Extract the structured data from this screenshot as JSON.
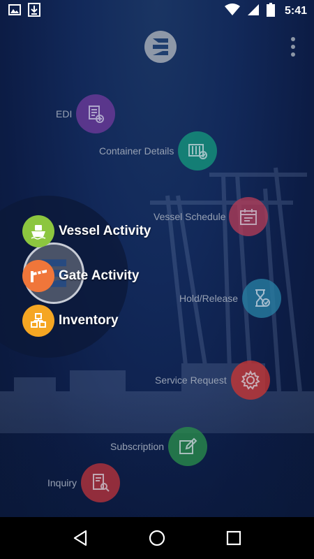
{
  "status_bar": {
    "time": "5:41",
    "icons": [
      "image-icon",
      "download-icon",
      "wifi-icon",
      "signal-icon",
      "battery-icon"
    ]
  },
  "app": {
    "logo_icon": "app-logo-icon",
    "menu_icon": "overflow-menu-icon"
  },
  "dial": {
    "items": [
      {
        "label": "EDI",
        "icon": "edi-document-icon",
        "color": "#7b3fa3"
      },
      {
        "label": "Container Details",
        "icon": "container-icon",
        "color": "#16a085"
      },
      {
        "label": "Vessel Schedule",
        "icon": "calendar-icon",
        "color": "#c2405a"
      },
      {
        "label": "Hold/Release",
        "icon": "hourglass-check-icon",
        "color": "#2b8cb3"
      },
      {
        "label": "Service Request",
        "icon": "gear-icon",
        "color": "#d83a38"
      },
      {
        "label": "Subscription",
        "icon": "edit-icon",
        "color": "#2e9a52"
      },
      {
        "label": "Inquiry",
        "icon": "search-document-icon",
        "color": "#c8383f"
      }
    ]
  },
  "menu": {
    "items": [
      {
        "label": "Vessel Activity",
        "icon": "ship-icon",
        "color": "#8cc63f"
      },
      {
        "label": "Gate Activity",
        "icon": "gate-barrier-icon",
        "color": "#f0763a"
      },
      {
        "label": "Inventory",
        "icon": "inventory-boxes-icon",
        "color": "#f5a623"
      }
    ]
  },
  "nav_bar": {
    "buttons": [
      "back-icon",
      "home-icon",
      "recents-icon"
    ]
  }
}
